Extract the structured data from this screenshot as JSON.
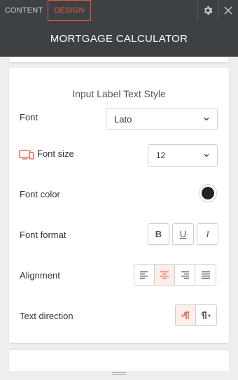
{
  "tabs": {
    "content": "CONTENT",
    "design": "DESIGN"
  },
  "header": {
    "title": "MORTGAGE CALCULATOR"
  },
  "section": {
    "title": "Input Label Text Style"
  },
  "rows": {
    "font": {
      "label": "Font",
      "value": "Lato"
    },
    "font_size": {
      "label": "Font size",
      "value": "12"
    },
    "font_color": {
      "label": "Font color",
      "value": "#222222"
    },
    "font_format": {
      "label": "Font format",
      "bold": "B",
      "underline": "U",
      "italic": "I"
    },
    "alignment": {
      "label": "Alignment",
      "selected": "center"
    },
    "text_direction": {
      "label": "Text direction",
      "selected": "ltr"
    }
  },
  "colors": {
    "accent": "#e3573c",
    "topbar": "#3d4144"
  },
  "icons": {
    "settings": "gear-icon",
    "close": "close-icon",
    "device": "desktop-mobile-icon"
  }
}
